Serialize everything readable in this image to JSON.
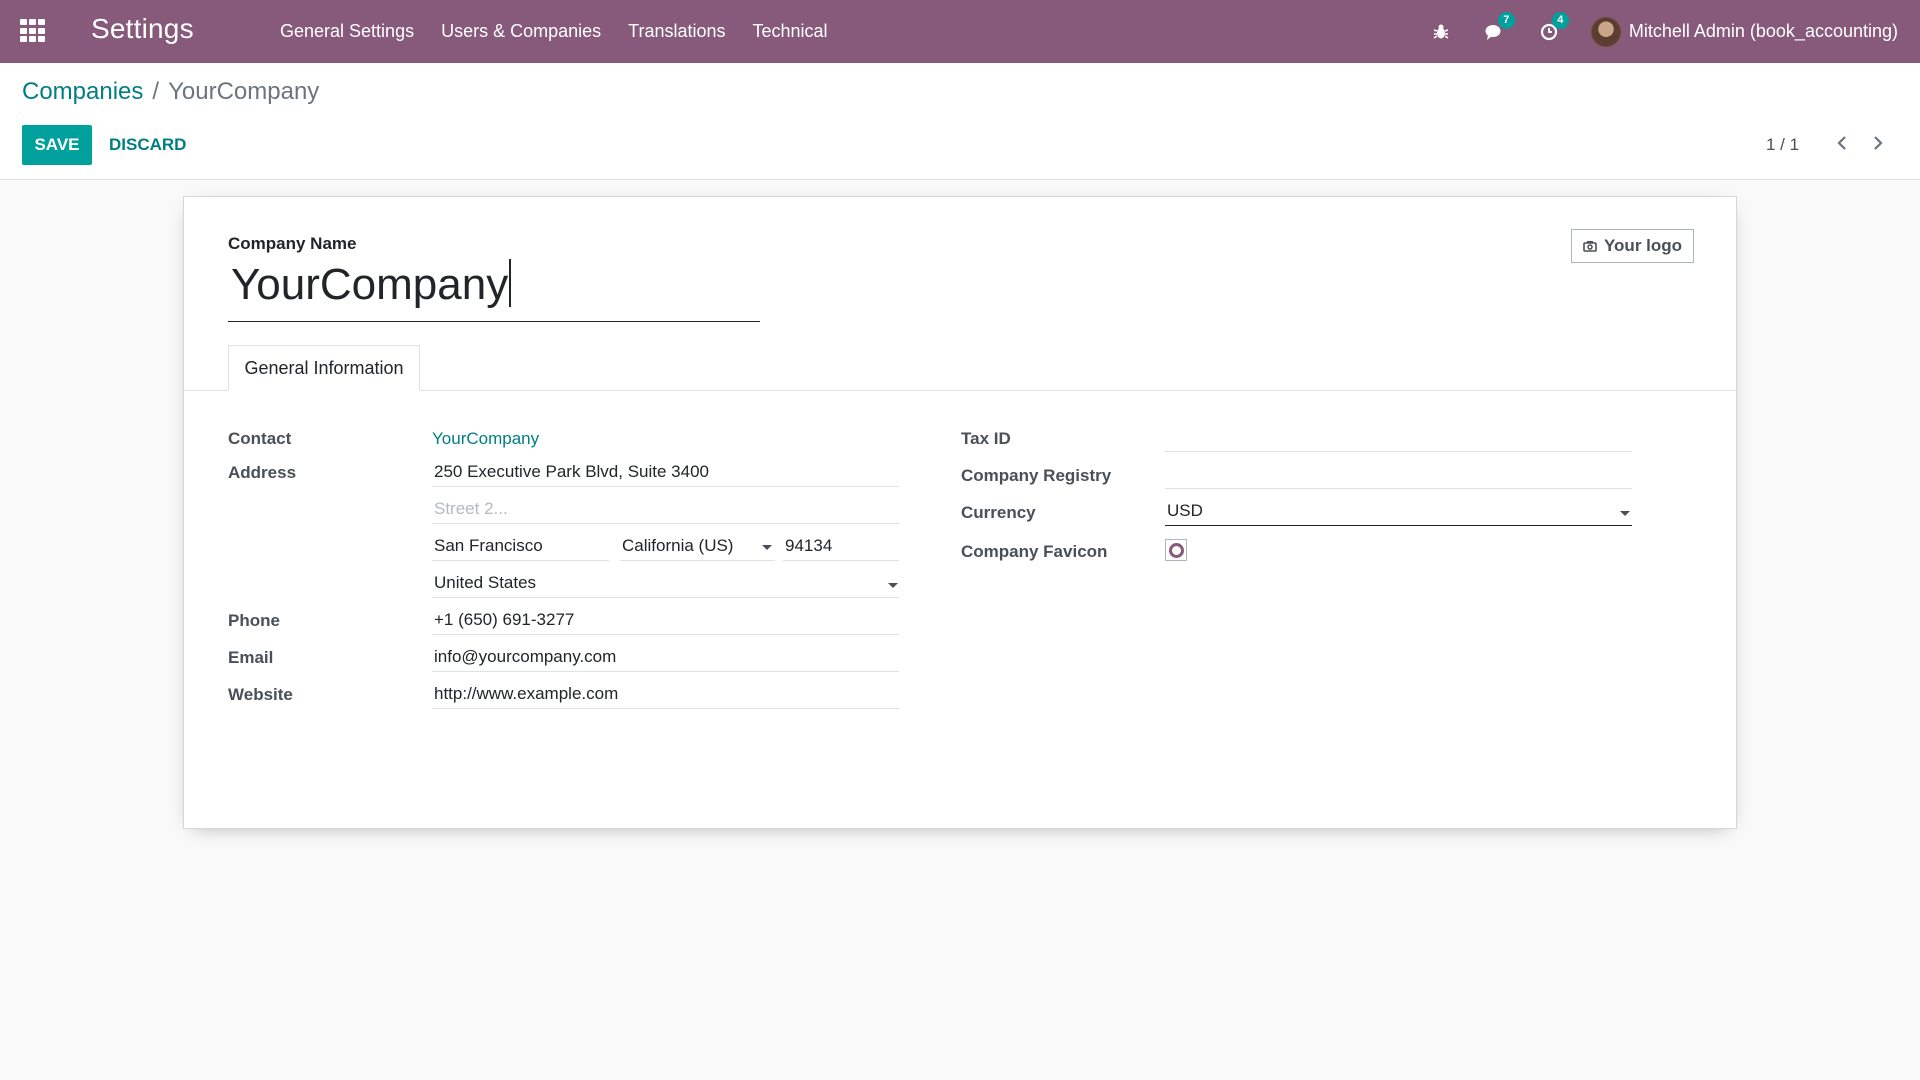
{
  "navbar": {
    "app_title": "Settings",
    "menu": [
      "General Settings",
      "Users & Companies",
      "Translations",
      "Technical"
    ],
    "messages_badge": "7",
    "activities_badge": "4",
    "user_name": "Mitchell Admin (book_accounting)"
  },
  "breadcrumb": {
    "parent": "Companies",
    "separator": "/",
    "current": "YourCompany"
  },
  "buttons": {
    "save": "SAVE",
    "discard": "DISCARD",
    "logo": "Your logo"
  },
  "pager": {
    "value": "1 / 1"
  },
  "form": {
    "company_name_label": "Company Name",
    "company_name": "YourCompany",
    "tab": "General Information",
    "labels": {
      "contact": "Contact",
      "address": "Address",
      "phone": "Phone",
      "email": "Email",
      "website": "Website",
      "tax_id": "Tax ID",
      "company_registry": "Company Registry",
      "currency": "Currency",
      "company_favicon": "Company Favicon"
    },
    "values": {
      "contact": "YourCompany",
      "street": "250 Executive Park Blvd, Suite 3400",
      "street2_placeholder": "Street 2...",
      "city": "San Francisco",
      "state": "California (US)",
      "zip": "94134",
      "country": "United States",
      "phone": "+1 (650) 691-3277",
      "email": "info@yourcompany.com",
      "website": "http://www.example.com",
      "tax_id": "",
      "company_registry": "",
      "currency": "USD"
    }
  },
  "colors": {
    "navbar": "#875a7b",
    "primary": "#00a09d",
    "link": "#017e84"
  }
}
